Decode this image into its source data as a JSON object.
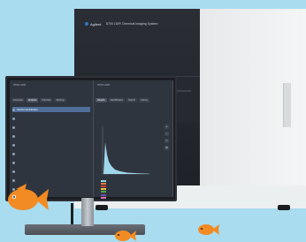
{
  "instrument": {
    "brand": "Agilent",
    "model": "8700 LDIR Chemical Imaging System",
    "colors": {
      "front": "#23262c",
      "side": "#eef0f1",
      "accent": "#2d79c7"
    }
  },
  "monitor": {
    "left_pane": {
      "title": "8700 LDIR",
      "tabs": [
        "Overview",
        "Analysis",
        "Particles",
        "Settings"
      ],
      "filter_label": "Particle Identification",
      "rows": [
        {
          "label": "",
          "value": ""
        },
        {
          "label": "",
          "value": ""
        },
        {
          "label": "",
          "value": ""
        },
        {
          "label": "",
          "value": ""
        },
        {
          "label": "",
          "value": ""
        },
        {
          "label": "",
          "value": ""
        },
        {
          "label": "",
          "value": ""
        },
        {
          "label": "",
          "value": ""
        },
        {
          "label": "",
          "value": ""
        }
      ]
    },
    "right_pane": {
      "title": "8700 LDIR",
      "tabs": [
        "Results",
        "Identification",
        "Report",
        "Library"
      ],
      "legend": [
        {
          "label": "",
          "color": "#8fd3e8"
        },
        {
          "label": "",
          "color": "#e07b39"
        },
        {
          "label": "",
          "color": "#cf3b3b"
        },
        {
          "label": "",
          "color": "#e9c53a"
        },
        {
          "label": "",
          "color": "#4aa84e"
        },
        {
          "label": "",
          "color": "#6b4fb1"
        },
        {
          "label": "",
          "color": "#e06fb0"
        }
      ],
      "side_icons": [
        "zoom-in-icon",
        "zoom-out-icon",
        "fit-icon",
        "settings-icon"
      ]
    }
  },
  "decor": {
    "fish_color": "#f28b23"
  }
}
